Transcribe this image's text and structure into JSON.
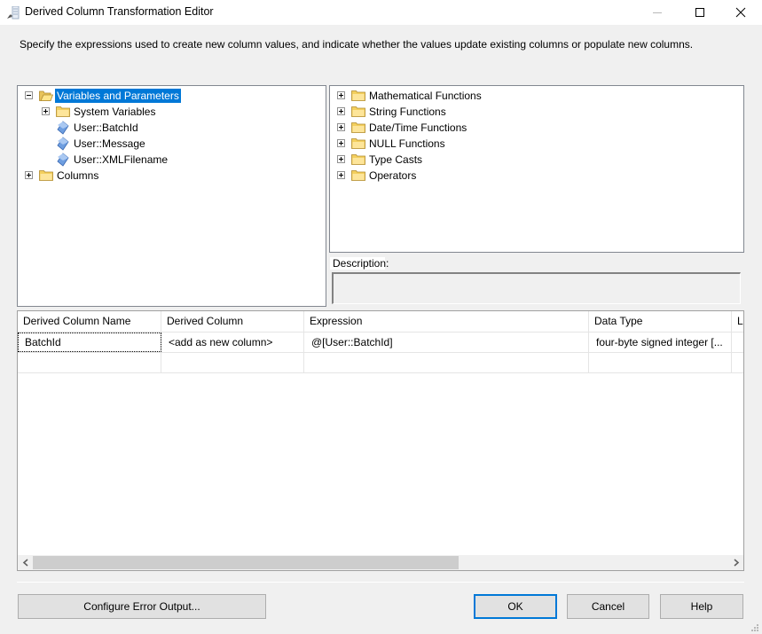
{
  "window": {
    "title": "Derived Column Transformation Editor",
    "controls": {
      "minimize": "minimize",
      "maximize": "maximize",
      "close": "close"
    }
  },
  "instructions": "Specify the expressions used to create new column values, and indicate whether the values update existing columns or populate new columns.",
  "left_tree": {
    "nodes": [
      {
        "label": "Variables and Parameters",
        "icon": "folder-open-icon",
        "expander": "minus",
        "selected": true
      },
      {
        "label": "System Variables",
        "icon": "folder-icon",
        "expander": "plus"
      },
      {
        "label": "User::BatchId",
        "icon": "variable-icon"
      },
      {
        "label": "User::Message",
        "icon": "variable-icon"
      },
      {
        "label": "User::XMLFilename",
        "icon": "variable-icon"
      },
      {
        "label": "Columns",
        "icon": "folder-icon",
        "expander": "plus"
      }
    ]
  },
  "right_tree": {
    "nodes": [
      {
        "label": "Mathematical Functions",
        "icon": "folder-icon",
        "expander": "plus"
      },
      {
        "label": "String Functions",
        "icon": "folder-icon",
        "expander": "plus"
      },
      {
        "label": "Date/Time Functions",
        "icon": "folder-icon",
        "expander": "plus"
      },
      {
        "label": "NULL Functions",
        "icon": "folder-icon",
        "expander": "plus"
      },
      {
        "label": "Type Casts",
        "icon": "folder-icon",
        "expander": "plus"
      },
      {
        "label": "Operators",
        "icon": "folder-icon",
        "expander": "plus"
      }
    ]
  },
  "description": {
    "label": "Description:",
    "value": ""
  },
  "grid": {
    "columns": [
      "Derived Column Name",
      "Derived Column",
      "Expression",
      "Data Type",
      "Le"
    ],
    "rows": [
      [
        "BatchId",
        "<add as new column>",
        "@[User::BatchId]",
        "four-byte signed integer [...",
        ""
      ],
      [
        "",
        "",
        "",
        "",
        ""
      ]
    ],
    "scroll": {
      "left_arrow": "‹",
      "right_arrow": "›"
    }
  },
  "buttons": {
    "configure_error_output": "Configure Error Output...",
    "ok": "OK",
    "cancel": "Cancel",
    "help": "Help"
  }
}
